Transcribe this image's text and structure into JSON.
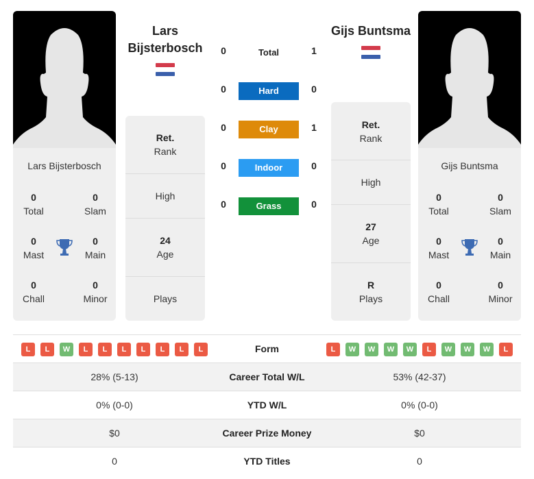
{
  "colors": {
    "hard": "#0a6bbf",
    "clay": "#de8a0a",
    "indoor": "#2b9cf2",
    "grass": "#12913a",
    "loss": "#eb5a44",
    "win": "#72bb72",
    "trophy": "#3d6bb3"
  },
  "player1": {
    "header_name_line1": "Lars",
    "header_name_line2": "Bijsterbosch",
    "card_name": "Lars Bijsterbosch",
    "flag": "netherlands-flag",
    "titles": {
      "total": "0",
      "total_label": "Total",
      "slam": "0",
      "slam_label": "Slam",
      "mast": "0",
      "mast_label": "Mast",
      "main": "0",
      "main_label": "Main",
      "chall": "0",
      "chall_label": "Chall",
      "minor": "0",
      "minor_label": "Minor"
    },
    "info": {
      "rank_value": "Ret.",
      "rank_label": "Rank",
      "high_label": "High",
      "age_value": "24",
      "age_label": "Age",
      "plays_label": "Plays"
    },
    "form": [
      "L",
      "L",
      "W",
      "L",
      "L",
      "L",
      "L",
      "L",
      "L",
      "L"
    ],
    "career_wl": "28% (5-13)",
    "ytd_wl": "0% (0-0)",
    "prize_money": "$0",
    "ytd_titles": "0"
  },
  "player2": {
    "header_name": "Gijs Buntsma",
    "card_name": "Gijs Buntsma",
    "flag": "netherlands-flag",
    "titles": {
      "total": "0",
      "total_label": "Total",
      "slam": "0",
      "slam_label": "Slam",
      "mast": "0",
      "mast_label": "Mast",
      "main": "0",
      "main_label": "Main",
      "chall": "0",
      "chall_label": "Chall",
      "minor": "0",
      "minor_label": "Minor"
    },
    "info": {
      "rank_value": "Ret.",
      "rank_label": "Rank",
      "high_label": "High",
      "age_value": "27",
      "age_label": "Age",
      "plays_value": "R",
      "plays_label": "Plays"
    },
    "form": [
      "L",
      "W",
      "W",
      "W",
      "W",
      "L",
      "W",
      "W",
      "W",
      "L"
    ],
    "career_wl": "53% (42-37)",
    "ytd_wl": "0% (0-0)",
    "prize_money": "$0",
    "ytd_titles": "0"
  },
  "h2h": {
    "total": {
      "label": "Total",
      "p1": "0",
      "p2": "1"
    },
    "hard": {
      "label": "Hard",
      "p1": "0",
      "p2": "0"
    },
    "clay": {
      "label": "Clay",
      "p1": "0",
      "p2": "1"
    },
    "indoor": {
      "label": "Indoor",
      "p1": "0",
      "p2": "0"
    },
    "grass": {
      "label": "Grass",
      "p1": "0",
      "p2": "0"
    }
  },
  "comparison": {
    "form_label": "Form",
    "career_wl_label": "Career Total W/L",
    "ytd_wl_label": "YTD W/L",
    "prize_label": "Career Prize Money",
    "ytd_titles_label": "YTD Titles"
  }
}
